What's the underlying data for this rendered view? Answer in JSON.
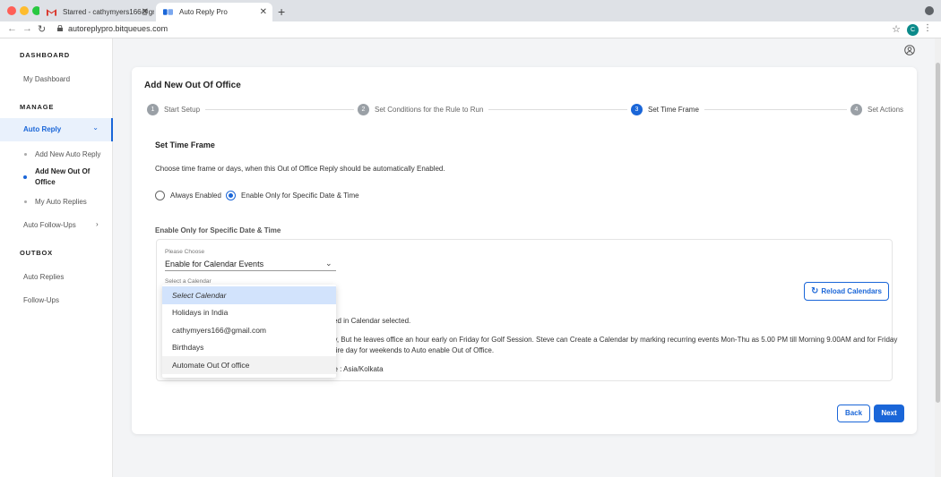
{
  "browser": {
    "tabs": [
      {
        "title": "Starred - cathymyers166@gm..."
      },
      {
        "title": "Auto Reply Pro"
      }
    ],
    "url": "autoreplypro.bitqueues.com",
    "profile_initial": "C"
  },
  "sidebar": {
    "dashboard_heading": "DASHBOARD",
    "my_dashboard": "My Dashboard",
    "manage_heading": "MANAGE",
    "auto_reply": "Auto Reply",
    "sub_items": [
      "Add New Auto Reply",
      "Add New Out Of Office",
      "My Auto Replies"
    ],
    "auto_followups": "Auto Follow-Ups",
    "outbox_heading": "OUTBOX",
    "auto_replies": "Auto Replies",
    "follow_ups": "Follow-Ups"
  },
  "main": {
    "title": "Add New Out Of Office",
    "steps": [
      {
        "num": "1",
        "label": "Start Setup"
      },
      {
        "num": "2",
        "label": "Set Conditions for the Rule to Run"
      },
      {
        "num": "3",
        "label": "Set Time Frame"
      },
      {
        "num": "4",
        "label": "Set Actions"
      }
    ],
    "section_title": "Set Time Frame",
    "description": "Choose time frame or days, when this Out of Office Reply should be automatically Enabled.",
    "radio_always": "Always Enabled",
    "radio_specific": "Enable Only for Specific Date & Time",
    "specific_heading": "Enable Only for Specific Date & Time",
    "choose_label": "Please Choose",
    "choose_value": "Enable for Calendar Events",
    "calendar_label": "Select a Calendar",
    "reload_label": "Reload Calendars",
    "info_line1": "fied in Calendar selected.",
    "info_line2": "ay, But he leaves office an hour early on Friday for Golf Session. Steve can Create a Calendar by marking recurring events Mon-Thu as 5.00 PM till Morning 9.00AM and for Friday",
    "info_line3": "ntire day for weekends to Auto enable Out of Office.",
    "info_line4": "ne : Asia/Kolkata",
    "back_label": "Back",
    "next_label": "Next"
  },
  "dropdown": {
    "options": [
      "Select Calendar",
      "Holidays in India",
      "cathymyers166@gmail.com",
      "Birthdays",
      "Automate Out Of office"
    ]
  },
  "colors": {
    "accent": "#1a66d8"
  }
}
